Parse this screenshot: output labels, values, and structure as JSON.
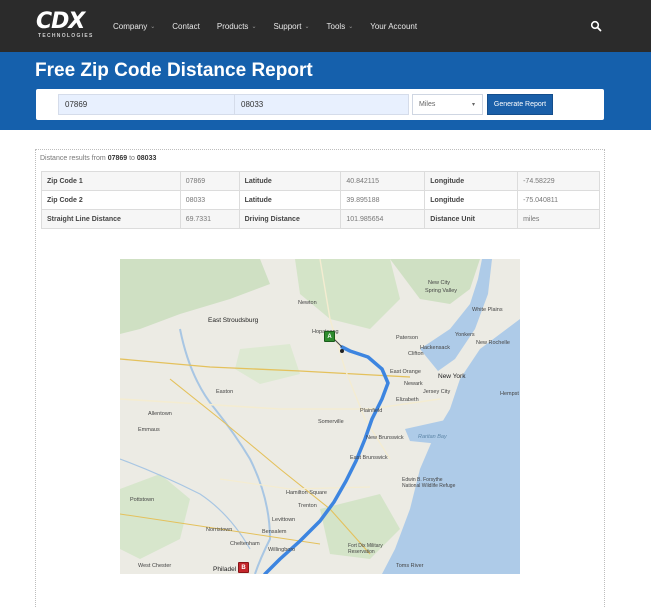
{
  "brand": {
    "logo_text": "CDX",
    "logo_subtext": "TECHNOLOGIES"
  },
  "nav": {
    "items": [
      {
        "label": "Company",
        "has_caret": true
      },
      {
        "label": "Contact",
        "has_caret": false
      },
      {
        "label": "Products",
        "has_caret": true
      },
      {
        "label": "Support",
        "has_caret": true
      },
      {
        "label": "Tools",
        "has_caret": true
      },
      {
        "label": "Your Account",
        "has_caret": false
      }
    ],
    "caret_glyph": "⌄"
  },
  "page": {
    "title": "Free Zip Code Distance Report"
  },
  "form": {
    "zip1_value": "07869",
    "zip2_value": "08033",
    "unit_selected": "Miles",
    "generate_label": "Generate Report"
  },
  "results": {
    "prefix": "Distance results from ",
    "from": "07869",
    "mid": " to ",
    "to": "08033",
    "rows": [
      [
        "Zip Code 1",
        "07869",
        "Latitude",
        "40.842115",
        "Longitude",
        "-74.58229"
      ],
      [
        "Zip Code 2",
        "08033",
        "Latitude",
        "39.895188",
        "Longitude",
        "-75.040811"
      ],
      [
        "Straight Line Distance",
        "69.7331",
        "Driving Distance",
        "101.985654",
        "Distance Unit",
        "miles"
      ]
    ]
  },
  "map": {
    "marker_a": "A",
    "marker_b": "B",
    "place_labels": [
      "Newton",
      "East Stroudsburg",
      "New City",
      "Spring Valley",
      "White Plains",
      "Paterson",
      "Hackensack",
      "Yonkers",
      "New Rochelle",
      "Clifton",
      "New York",
      "East Orange",
      "Newark",
      "Jersey City",
      "Hempst",
      "Elizabeth",
      "Easton",
      "Allentown",
      "Emmaus",
      "Plainfield",
      "Somerville",
      "New Brunswick",
      "Raritan Bay",
      "East Brunswick",
      "Pottstown",
      "Hamilton Square",
      "Trenton",
      "Levittown",
      "Norristown",
      "Bensalem",
      "Cheltenham",
      "Willingboro",
      "West Chester",
      "Philadel",
      "Fort Dix Military Reservation",
      "Edwin B. Forsythe National Wildlife Refuge",
      "Toms River",
      "Hopatcong"
    ],
    "route_color": "#3d85e0"
  }
}
